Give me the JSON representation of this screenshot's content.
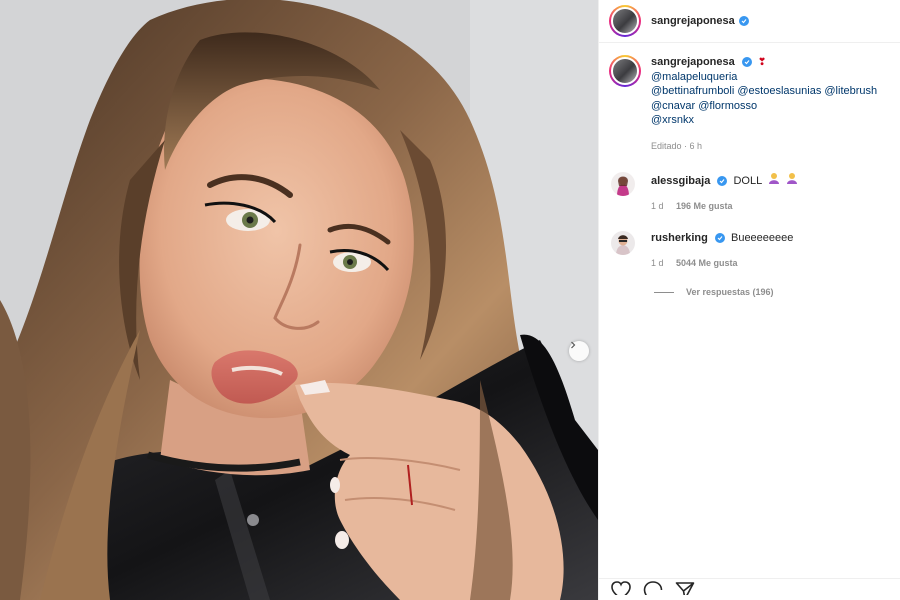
{
  "post": {
    "author": "sangrejaponesa",
    "verified": true
  },
  "caption": {
    "author": "sangrejaponesa",
    "emoji": "❣",
    "mentions": [
      [
        "@malapeluqueria"
      ],
      [
        "@bettinafrumboli",
        "@estoeslasunias",
        "@litebrush"
      ],
      [
        "@cnavar",
        "@flormosso"
      ],
      [
        "@xrsnkx"
      ]
    ],
    "meta": "Editado · 6 h"
  },
  "comments": [
    {
      "user": "alessgibaja",
      "verified": true,
      "text": "DOLL",
      "time": "1 d",
      "likes": "196 Me gusta"
    },
    {
      "user": "rusherking",
      "verified": true,
      "text": "Bueeeeeeee",
      "time": "1 d",
      "likes": "5044 Me gusta"
    }
  ],
  "replies": {
    "label": "Ver respuestas (196)"
  },
  "icons": [
    "verified-badge-icon",
    "next-arrow-icon",
    "heart-icon",
    "comment-icon",
    "share-icon"
  ],
  "colors": {
    "link": "#00376b",
    "verified": "#3897f0",
    "muted": "#8e8e8e"
  }
}
